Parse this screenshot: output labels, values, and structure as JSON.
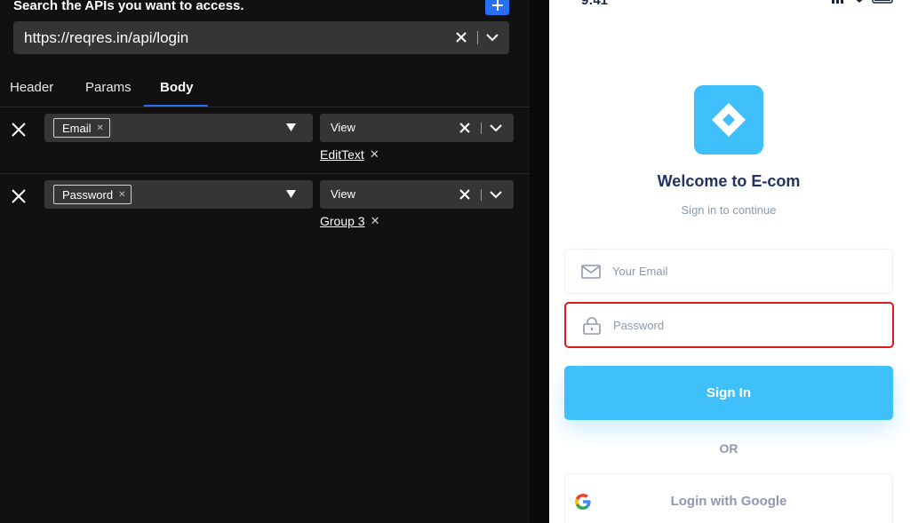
{
  "api_panel": {
    "title": "Search the APIs you want to access.",
    "url": "https://reqres.in/api/login",
    "tabs": [
      {
        "label": "Header"
      },
      {
        "label": "Params"
      },
      {
        "label": "Body"
      }
    ],
    "active_tab": "Body",
    "rows": [
      {
        "key": "Email",
        "value": "View",
        "link": "EditText"
      },
      {
        "key": "Password",
        "value": "View",
        "link": "Group 3"
      }
    ],
    "accent_color": "#2a6ef5"
  },
  "phone": {
    "status_time": "9:41",
    "logo_color": "#40c0fb",
    "welcome": "Welcome to E-com",
    "subtitle": "Sign in to continue",
    "email_placeholder": "Your Email",
    "password_placeholder": "Password",
    "signin_label": "Sign In",
    "or_label": "OR",
    "google_label": "Login with Google",
    "highlight_color": "#e0191c"
  }
}
